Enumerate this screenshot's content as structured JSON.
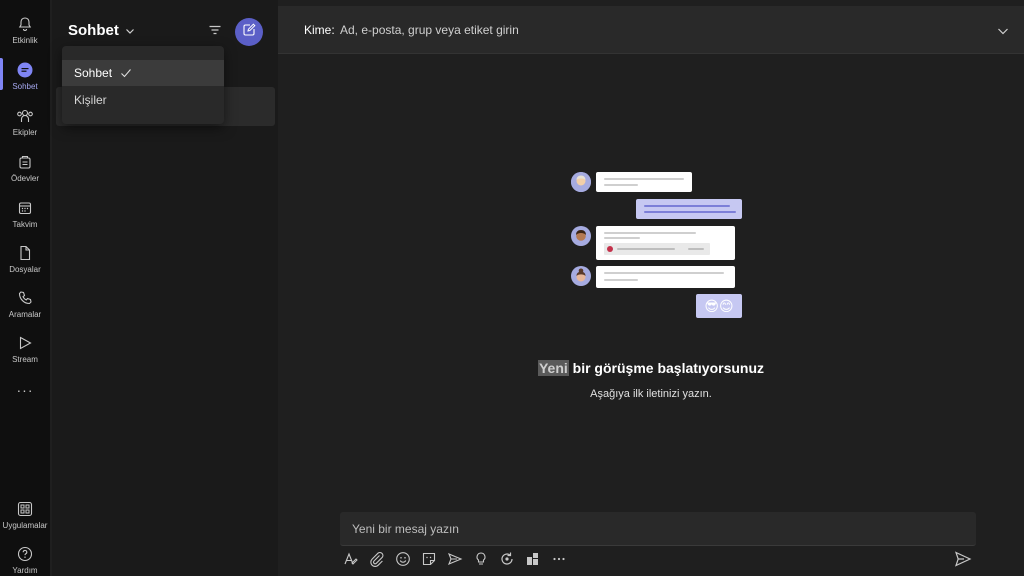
{
  "rail": {
    "items": [
      {
        "label": "Etkinlik",
        "icon": "bell-icon"
      },
      {
        "label": "Sohbet",
        "icon": "chat-icon"
      },
      {
        "label": "Ekipler",
        "icon": "teams-icon"
      },
      {
        "label": "Ödevler",
        "icon": "assignments-icon"
      },
      {
        "label": "Takvim",
        "icon": "calendar-icon"
      },
      {
        "label": "Dosyalar",
        "icon": "file-icon"
      },
      {
        "label": "Aramalar",
        "icon": "phone-icon"
      },
      {
        "label": "Stream",
        "icon": "stream-icon"
      },
      {
        "label": "Uygulamalar",
        "icon": "apps-icon"
      },
      {
        "label": "Yardım",
        "icon": "help-icon"
      }
    ],
    "more": "···"
  },
  "list": {
    "title": "Sohbet"
  },
  "dropdown": {
    "items": [
      {
        "label": "Sohbet",
        "selected": true
      },
      {
        "label": "Kişiler",
        "selected": false
      }
    ]
  },
  "topbar": {
    "to_label": "Kime:",
    "to_placeholder": "Ad, e-posta, grup veya etiket girin"
  },
  "main": {
    "headline_highlight": "Yeni",
    "headline_rest": " bir görüşme başlatıyorsunuz",
    "subline": "Aşağıya ilk iletinizi yazın.",
    "emojis": "😎😊"
  },
  "compose": {
    "placeholder": "Yeni bir mesaj yazın"
  },
  "colors": {
    "accent": "#5b5fc7",
    "accent_light": "#7f85f5",
    "rail_bg": "#0f0f0f",
    "pane_bg": "#1a1a1a",
    "main_bg": "#1f1f1f"
  }
}
